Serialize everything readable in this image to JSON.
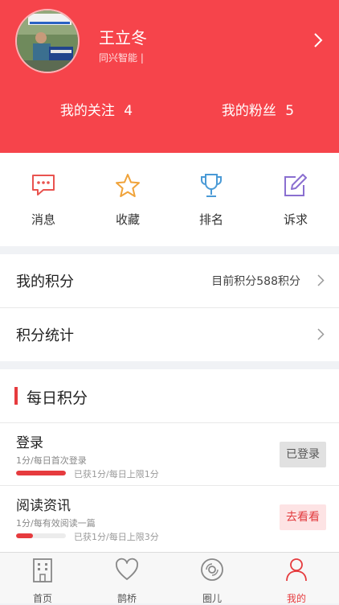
{
  "profile": {
    "name": "王立冬",
    "organization": "同兴智能 |",
    "following_label": "我的关注",
    "following_count": "4",
    "followers_label": "我的粉丝",
    "followers_count": "5"
  },
  "actions": [
    {
      "label": "消息",
      "icon": "message-icon",
      "color": "#e9534f"
    },
    {
      "label": "收藏",
      "icon": "star-icon",
      "color": "#f0a33a"
    },
    {
      "label": "排名",
      "icon": "trophy-icon",
      "color": "#4a9ad6"
    },
    {
      "label": "诉求",
      "icon": "edit-icon",
      "color": "#8a6fd0"
    }
  ],
  "points": {
    "my_points_label": "我的积分",
    "my_points_value": "目前积分588积分",
    "stats_label": "积分统计"
  },
  "daily": {
    "title": "每日积分",
    "tasks": [
      {
        "title": "登录",
        "subtitle": "1分/每日首次登录",
        "progress_text": "已获1分/每日上限1分",
        "progress": 1.0,
        "button": "已登录"
      },
      {
        "title": "阅读资讯",
        "subtitle": "1分/每有效阅读一篇",
        "progress_text": "已获1分/每日上限3分",
        "progress": 0.333,
        "button": "去看看"
      }
    ]
  },
  "tabs": [
    {
      "label": "首页",
      "icon": "building-icon"
    },
    {
      "label": "鹊桥",
      "icon": "heart-icon"
    },
    {
      "label": "圈儿",
      "icon": "disc-icon"
    },
    {
      "label": "我的",
      "icon": "user-icon",
      "active": true
    }
  ],
  "colors": {
    "brand": "#f6444b",
    "accent": "#e63b3e"
  }
}
